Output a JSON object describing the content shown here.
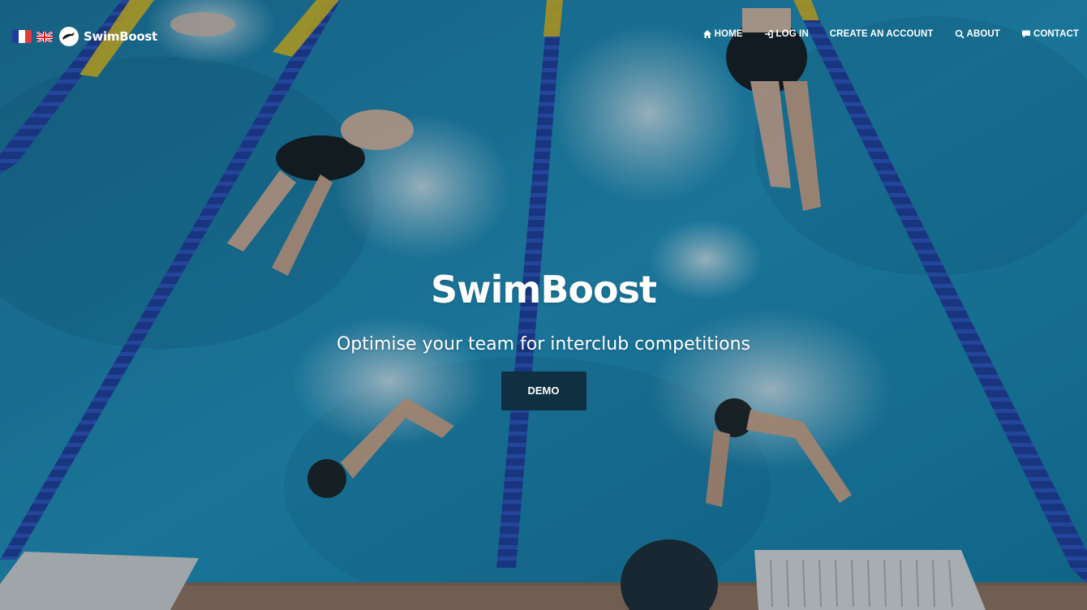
{
  "brand": {
    "name": "SwimBoost",
    "flags": [
      {
        "icon": "france-flag-icon"
      },
      {
        "icon": "uk-flag-icon"
      }
    ],
    "logo_icon": "swimmer-logo-icon"
  },
  "nav": {
    "items": [
      {
        "label": "HOME",
        "icon": "home-icon"
      },
      {
        "label": "LOG IN",
        "icon": "login-icon"
      },
      {
        "label": "CREATE AN ACCOUNT",
        "icon": ""
      },
      {
        "label": "ABOUT",
        "icon": "search-icon"
      },
      {
        "label": "CONTACT",
        "icon": "comment-icon"
      }
    ]
  },
  "hero": {
    "title": "SwimBoost",
    "subtitle": "Optimise your team for interclub competitions",
    "cta_label": "DEMO"
  },
  "colors": {
    "pool_water": "#1a8fb8",
    "lane_rope": "#1d3f9c",
    "button_bg": "#0f3040",
    "text": "#ffffff"
  }
}
